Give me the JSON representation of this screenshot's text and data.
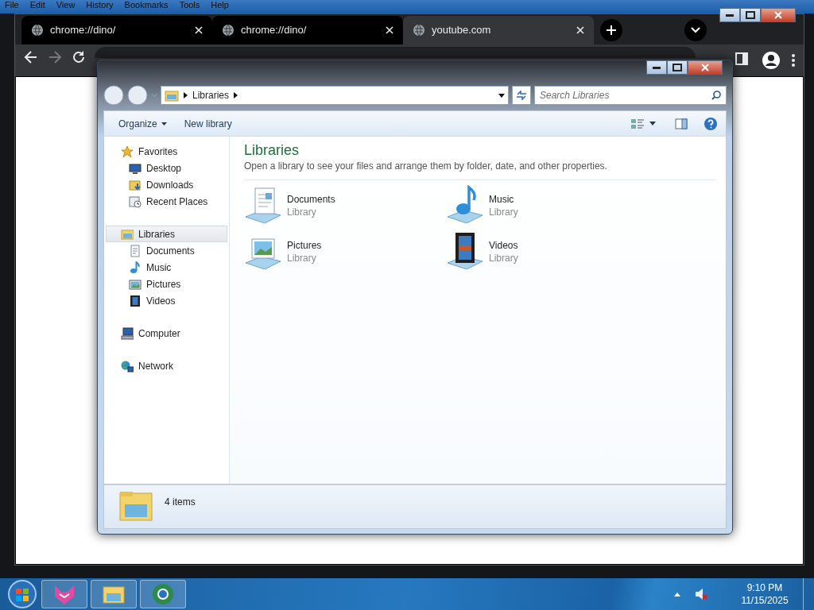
{
  "app_menu": [
    "File",
    "Edit",
    "View",
    "History",
    "Bookmarks",
    "Tools",
    "Help"
  ],
  "browser": {
    "tabs": [
      {
        "title": "chrome://dino/",
        "selected": false
      },
      {
        "title": "chrome://dino/",
        "selected": false
      },
      {
        "title": "youtube.com",
        "selected": true
      }
    ]
  },
  "explorer": {
    "breadcrumb": [
      "Libraries"
    ],
    "search": {
      "placeholder": "Search Libraries"
    },
    "commands": [
      "Organize",
      "New library"
    ],
    "nav": [
      {
        "label": "Favorites",
        "kind": "favorites",
        "selected": false,
        "children": [
          {
            "label": "Desktop",
            "kind": "desktop",
            "selected": false
          },
          {
            "label": "Downloads",
            "kind": "downloads",
            "selected": false
          },
          {
            "label": "Recent Places",
            "kind": "recent",
            "selected": false
          }
        ]
      },
      {
        "label": "Libraries",
        "kind": "libraries",
        "selected": true,
        "children": [
          {
            "label": "Documents",
            "kind": "documents",
            "selected": false
          },
          {
            "label": "Music",
            "kind": "music",
            "selected": false
          },
          {
            "label": "Pictures",
            "kind": "pictures",
            "selected": false
          },
          {
            "label": "Videos",
            "kind": "videos",
            "selected": false
          }
        ]
      },
      {
        "label": "Computer",
        "kind": "computer",
        "selected": false
      },
      {
        "label": "Network",
        "kind": "network",
        "selected": false
      }
    ],
    "heading": "Libraries",
    "description": "Open a library to see your files and arrange them by folder, date, and other properties.",
    "libraries": [
      {
        "name": "Documents",
        "type": "Library",
        "kind": "documents"
      },
      {
        "name": "Music",
        "type": "Library",
        "kind": "music"
      },
      {
        "name": "Pictures",
        "type": "Library",
        "kind": "pictures"
      },
      {
        "name": "Videos",
        "type": "Library",
        "kind": "videos"
      }
    ],
    "status": "4 items"
  },
  "taskbar": {
    "apps": [
      {
        "kind": "fox"
      },
      {
        "kind": "explorer"
      },
      {
        "kind": "browser"
      }
    ],
    "time": "9:10 PM",
    "date": "11/15/2025"
  }
}
